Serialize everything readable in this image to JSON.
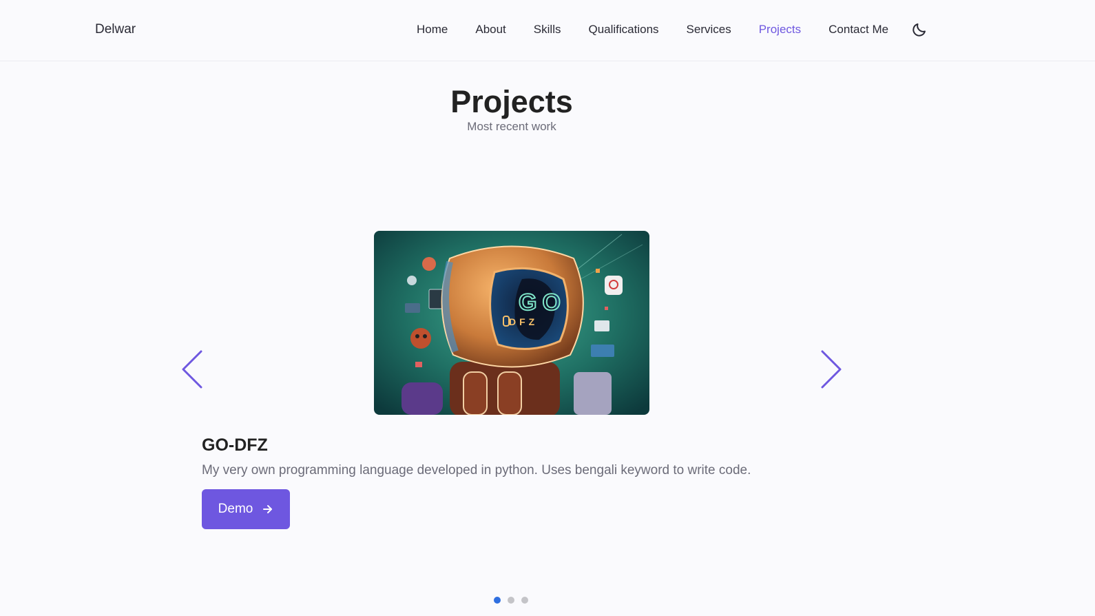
{
  "header": {
    "logo": "Delwar",
    "nav": [
      {
        "label": "Home",
        "active": false
      },
      {
        "label": "About",
        "active": false
      },
      {
        "label": "Skills",
        "active": false
      },
      {
        "label": "Qualifications",
        "active": false
      },
      {
        "label": "Services",
        "active": false
      },
      {
        "label": "Projects",
        "active": true
      },
      {
        "label": "Contact Me",
        "active": false
      }
    ],
    "theme_toggle_icon": "moon-icon"
  },
  "section": {
    "title": "Projects",
    "subtitle": "Most recent work"
  },
  "project": {
    "image_icon": "robot-illustration",
    "image_text_top": "GO",
    "image_text_bottom": "DFZ",
    "title": "GO-DFZ",
    "description": "My very own programming language developed in python. Uses bengali keyword to write code.",
    "button_label": "Demo",
    "button_icon": "arrow-right-icon"
  },
  "carousel": {
    "prev_icon": "chevron-left-icon",
    "next_icon": "chevron-right-icon",
    "slides": 3,
    "active_slide": 1
  },
  "colors": {
    "accent": "#6e57e0",
    "pagination_active": "#2f6fe0",
    "background": "#fafafd"
  }
}
